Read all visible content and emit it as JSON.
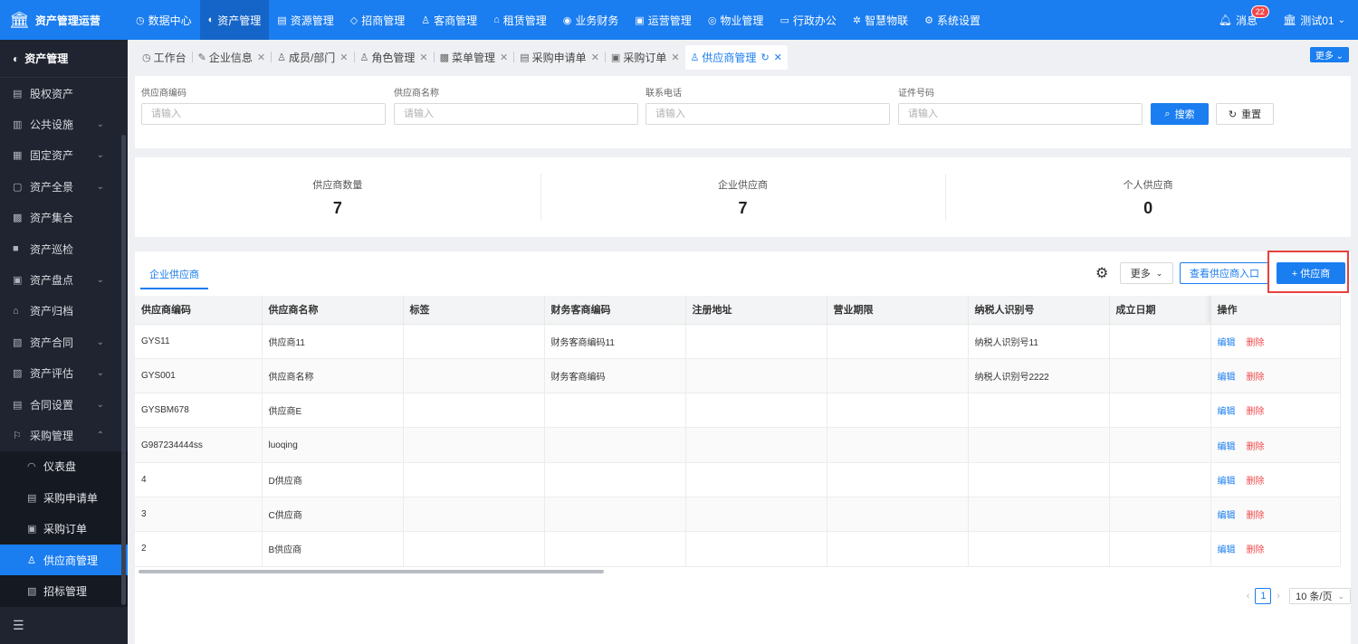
{
  "app": {
    "title": "资产管理运营"
  },
  "topnav": [
    {
      "icon": "◷",
      "label": "数据中心"
    },
    {
      "icon": "◐",
      "label": "资产管理"
    },
    {
      "icon": "▤",
      "label": "资源管理"
    },
    {
      "icon": "◇",
      "label": "招商管理"
    },
    {
      "icon": "♙",
      "label": "客商管理"
    },
    {
      "icon": "⌂",
      "label": "租赁管理"
    },
    {
      "icon": "◉",
      "label": "业务财务"
    },
    {
      "icon": "▣",
      "label": "运营管理"
    },
    {
      "icon": "◎",
      "label": "物业管理"
    },
    {
      "icon": "▭",
      "label": "行政办公"
    },
    {
      "icon": "✲",
      "label": "智慧物联"
    },
    {
      "icon": "⚙",
      "label": "系统设置"
    }
  ],
  "header": {
    "messages_label": "消息",
    "messages_count": "22",
    "user_name": "测试01"
  },
  "sidebar": {
    "title": "资产管理",
    "items": [
      {
        "icon": "▤",
        "label": "股权资产",
        "chevron": ""
      },
      {
        "icon": "▥",
        "label": "公共设施",
        "chevron": "⌄"
      },
      {
        "icon": "▦",
        "label": "固定资产",
        "chevron": "⌄"
      },
      {
        "icon": "▢",
        "label": "资产全景",
        "chevron": "⌄"
      },
      {
        "icon": "▩",
        "label": "资产集合",
        "chevron": ""
      },
      {
        "icon": "■",
        "label": "资产巡检",
        "chevron": ""
      },
      {
        "icon": "▣",
        "label": "资产盘点",
        "chevron": "⌄"
      },
      {
        "icon": "⌂",
        "label": "资产归档",
        "chevron": ""
      },
      {
        "icon": "▧",
        "label": "资产合同",
        "chevron": "⌄"
      },
      {
        "icon": "▨",
        "label": "资产评估",
        "chevron": "⌄"
      },
      {
        "icon": "▤",
        "label": "合同设置",
        "chevron": "⌄"
      },
      {
        "icon": "⚐",
        "label": "采购管理",
        "chevron": "⌃"
      }
    ],
    "subitems": [
      {
        "icon": "◠",
        "label": "仪表盘"
      },
      {
        "icon": "▤",
        "label": "采购申请单"
      },
      {
        "icon": "▣",
        "label": "采购订单"
      },
      {
        "icon": "♙",
        "label": "供应商管理"
      },
      {
        "icon": "▧",
        "label": "招标管理"
      }
    ],
    "collapse_icon": "☰"
  },
  "tabs": [
    {
      "icon": "◷",
      "label": "工作台",
      "closable": false
    },
    {
      "icon": "✎",
      "label": "企业信息",
      "closable": true
    },
    {
      "icon": "♙",
      "label": "成员/部门",
      "closable": true
    },
    {
      "icon": "♙",
      "label": "角色管理",
      "closable": true
    },
    {
      "icon": "▩",
      "label": "菜单管理",
      "closable": true
    },
    {
      "icon": "▤",
      "label": "采购申请单",
      "closable": true
    },
    {
      "icon": "▣",
      "label": "采购订单",
      "closable": true
    },
    {
      "icon": "♙",
      "label": "供应商管理",
      "closable": true
    }
  ],
  "tabs_more": "更多 ⌄",
  "search": {
    "fields": [
      {
        "label": "供应商编码",
        "placeholder": "请输入"
      },
      {
        "label": "供应商名称",
        "placeholder": "请输入"
      },
      {
        "label": "联系电话",
        "placeholder": "请输入"
      },
      {
        "label": "证件号码",
        "placeholder": "请输入"
      }
    ],
    "search_button": "搜索",
    "reset_button": "重置"
  },
  "stats": [
    {
      "label": "供应商数量",
      "value": "7"
    },
    {
      "label": "企业供应商",
      "value": "7"
    },
    {
      "label": "个人供应商",
      "value": "0"
    }
  ],
  "list": {
    "tab_label": "企业供应商",
    "more_label": "更多",
    "view_entry_label": "查看供应商入口",
    "add_label": "+ 供应商",
    "columns": [
      "供应商编码",
      "供应商名称",
      "标签",
      "财务客商编码",
      "注册地址",
      "营业期限",
      "纳税人识别号",
      "成立日期",
      "操作"
    ],
    "rows": [
      {
        "code": "GYS11",
        "name": "供应商11",
        "tag": "",
        "fin": "财务客商编码11",
        "addr": "",
        "term": "",
        "tax": "纳税人识别号11",
        "date": ""
      },
      {
        "code": "GYS001",
        "name": "供应商名称",
        "tag": "",
        "fin": "财务客商编码",
        "addr": "",
        "term": "",
        "tax": "纳税人识别号2222",
        "date": ""
      },
      {
        "code": "GYSBM678",
        "name": "供应商E",
        "tag": "",
        "fin": "",
        "addr": "",
        "term": "",
        "tax": "",
        "date": ""
      },
      {
        "code": "G987234444ss",
        "name": "luoqing",
        "tag": "",
        "fin": "",
        "addr": "",
        "term": "",
        "tax": "",
        "date": ""
      },
      {
        "code": "4",
        "name": "D供应商",
        "tag": "",
        "fin": "",
        "addr": "",
        "term": "",
        "tax": "",
        "date": ""
      },
      {
        "code": "3",
        "name": "C供应商",
        "tag": "",
        "fin": "",
        "addr": "",
        "term": "",
        "tax": "",
        "date": ""
      },
      {
        "code": "2",
        "name": "B供应商",
        "tag": "",
        "fin": "",
        "addr": "",
        "term": "",
        "tax": "",
        "date": ""
      }
    ],
    "edit_label": "编辑",
    "delete_label": "删除"
  },
  "pagination": {
    "current_page": "1",
    "page_size": "10 条/页"
  },
  "colors": {
    "primary": "#1a7df0",
    "danger": "#f2474a",
    "sidebar_bg": "#1f2430"
  }
}
